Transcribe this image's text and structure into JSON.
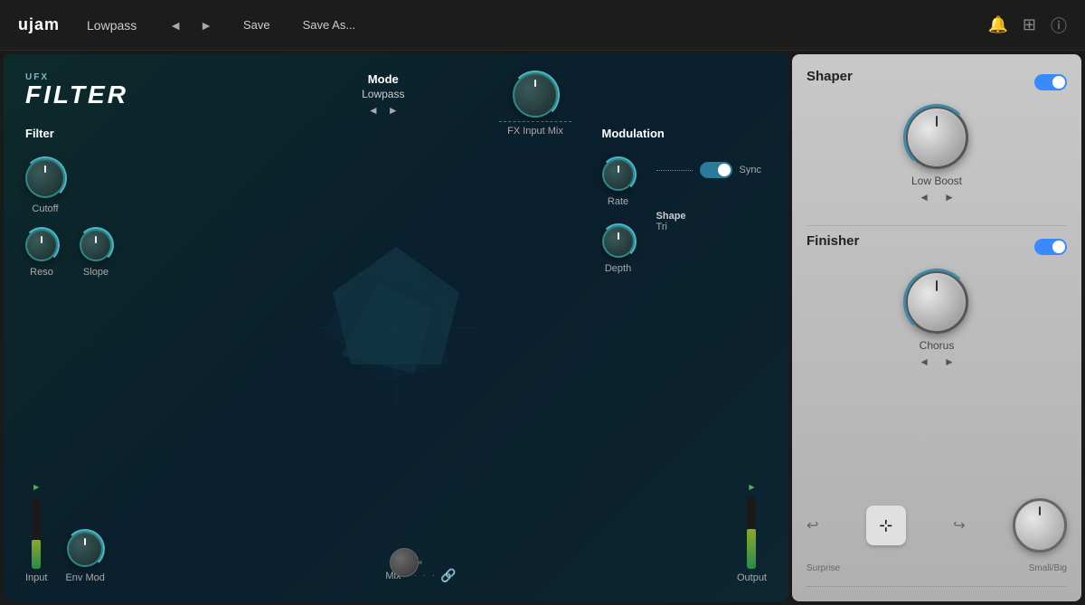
{
  "topbar": {
    "logo": "ujam",
    "preset_name": "Lowpass",
    "nav_prev": "◄",
    "nav_next": "►",
    "save_label": "Save",
    "save_as_label": "Save As...",
    "icon_notify": "🔔",
    "icon_expand": "⊞",
    "icon_info": "ⓘ"
  },
  "left_panel": {
    "ufx_label": "UFX",
    "plugin_name": "FILTER",
    "mode_label": "Mode",
    "mode_value": "Lowpass",
    "mode_prev": "◄",
    "mode_next": "►",
    "fx_input_mix_label": "FX Input Mix",
    "filter_section_title": "Filter",
    "cutoff_label": "Cutoff",
    "reso_label": "Reso",
    "slope_label": "Slope",
    "modulation_section_title": "Modulation",
    "rate_label": "Rate",
    "sync_label": "Sync",
    "depth_label": "Depth",
    "shape_label": "Shape",
    "shape_value": "Tri",
    "input_label": "Input",
    "env_mod_label": "Env Mod",
    "mix_label": "Mix",
    "output_label": "Output"
  },
  "right_panel": {
    "shaper_title": "Shaper",
    "shaper_enabled": true,
    "low_boost_label": "Low Boost",
    "low_boost_prev": "◄",
    "low_boost_next": "►",
    "finisher_title": "Finisher",
    "finisher_enabled": true,
    "chorus_label": "Chorus",
    "chorus_prev": "◄",
    "chorus_next": "►",
    "undo_icon": "↩",
    "surprise_icon": "⊹",
    "redo_icon": "↪",
    "surprise_label": "Surprise",
    "small_big_label": "Small/Big"
  }
}
